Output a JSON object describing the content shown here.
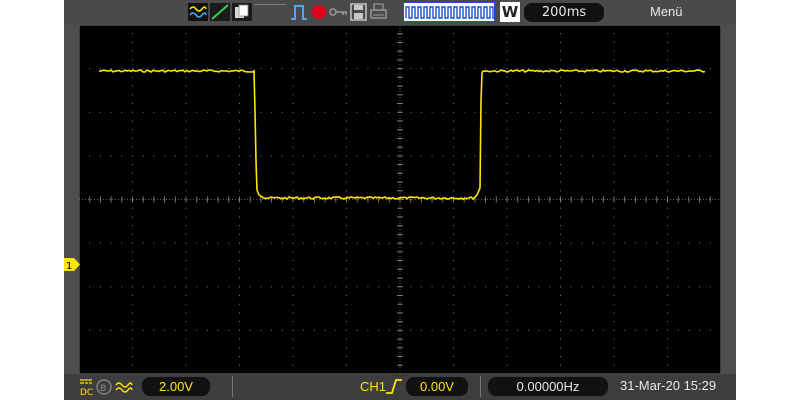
{
  "topbar": {
    "icons": [
      "signal-generator-icon",
      "slope-icon",
      "copy-icon"
    ],
    "run_state_icon": "pulse-icon",
    "record_indicator_color": "#e3001b",
    "timebase_strip_icon": "memory-waveform-icon",
    "trigger_mode": "W",
    "timebase": "200ms",
    "menu_label": "Menü"
  },
  "channel": {
    "marker": "1",
    "color": "#ffe600",
    "coupling_icon": "dc-coupling-icon",
    "volts_per_div": "2.00V"
  },
  "trigger": {
    "source": "CH1",
    "edge_icon": "rising-edge-icon",
    "level": "0.00V"
  },
  "status": {
    "frequency": "0.00000Hz",
    "datetime": "31-Mar-20 15:29"
  },
  "colors": {
    "screen": "#000000",
    "frame": "#4e4e4e",
    "grid": "#7a7a7a",
    "accent_blue": "#1a4fd6"
  }
}
